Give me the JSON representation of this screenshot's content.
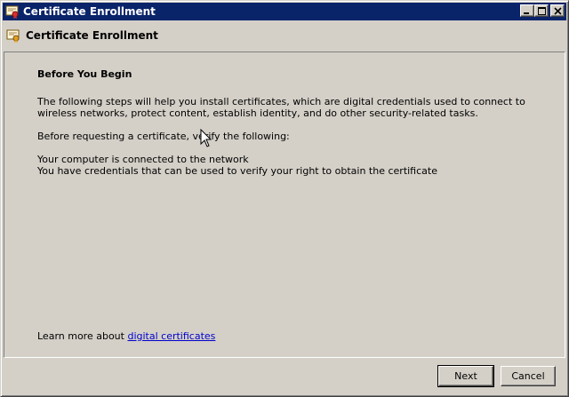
{
  "window": {
    "title": "Certificate Enrollment",
    "minimize_label": "Minimize",
    "maximize_label": "Maximize",
    "close_label": "Close"
  },
  "header": {
    "title": "Certificate Enrollment",
    "icon": "certificate-icon"
  },
  "content": {
    "heading": "Before You Begin",
    "intro": "The following steps will help you install certificates, which are digital credentials used to connect to wireless networks, protect content, establish identity, and do other security-related tasks.",
    "verify": "Before requesting a certificate, verify the following:",
    "requirements": [
      "Your computer is connected to the network",
      "You have credentials that can be used to verify your right to obtain the certificate"
    ],
    "learn_prefix": "Learn more about ",
    "learn_link": "digital certificates"
  },
  "buttons": {
    "next": "Next",
    "cancel": "Cancel"
  },
  "colors": {
    "titlebar": "#0a246a",
    "face": "#d4d0c8",
    "link": "#0000cc"
  }
}
